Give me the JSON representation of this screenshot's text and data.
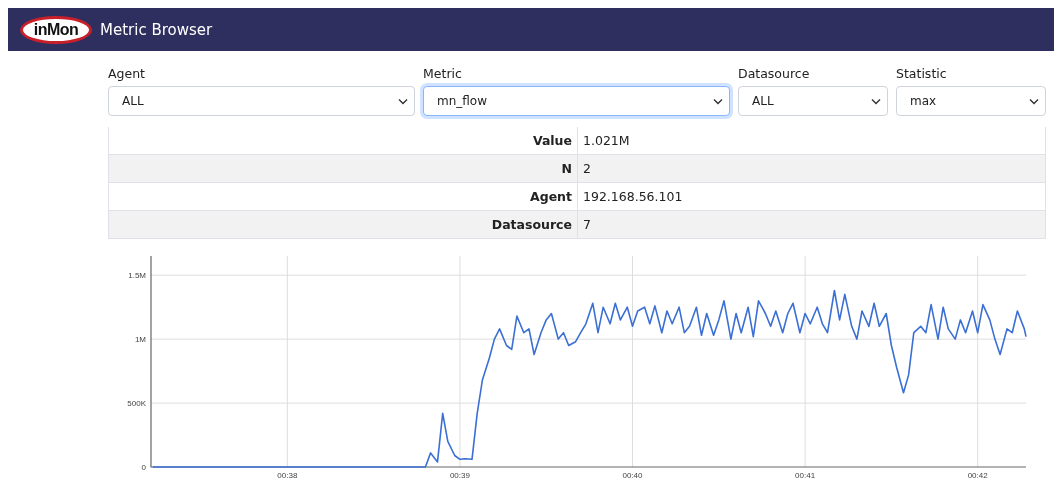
{
  "header": {
    "logo_text": "inMon",
    "title": "Metric Browser"
  },
  "filters": [
    {
      "label": "Agent",
      "value": "ALL",
      "focused": false
    },
    {
      "label": "Metric",
      "value": "mn_flow",
      "focused": true
    },
    {
      "label": "Datasource",
      "value": "ALL",
      "focused": false
    },
    {
      "label": "Statistic",
      "value": "max",
      "focused": false
    }
  ],
  "stats": [
    {
      "name": "Value",
      "value": "1.021M"
    },
    {
      "name": "N",
      "value": "2"
    },
    {
      "name": "Agent",
      "value": "192.168.56.101"
    },
    {
      "name": "Datasource",
      "value": "7"
    }
  ],
  "chart": {
    "chart_data": {
      "type": "line",
      "grid": true,
      "xlim": [
        37.21,
        42.28
      ],
      "ylim": [
        0,
        1650000
      ],
      "xticks": [
        {
          "value": 38,
          "label": "00:38"
        },
        {
          "value": 39,
          "label": "00:39"
        },
        {
          "value": 40,
          "label": "00:40"
        },
        {
          "value": 41,
          "label": "00:41"
        },
        {
          "value": 42,
          "label": "00:42"
        }
      ],
      "yticks": [
        {
          "value": 0,
          "label": "0"
        },
        {
          "value": 500000,
          "label": "500K"
        },
        {
          "value": 1000000,
          "label": "1M"
        },
        {
          "value": 1500000,
          "label": "1.5M"
        }
      ],
      "x": [
        37.22,
        38.8,
        38.83,
        38.87,
        38.9,
        38.93,
        38.97,
        39,
        39.03,
        39.07,
        39.1,
        39.13,
        39.17,
        39.2,
        39.23,
        39.27,
        39.3,
        39.33,
        39.37,
        39.4,
        39.43,
        39.47,
        39.5,
        39.53,
        39.57,
        39.6,
        39.63,
        39.67,
        39.7,
        39.73,
        39.77,
        39.8,
        39.83,
        39.87,
        39.9,
        39.93,
        39.97,
        40,
        40.03,
        40.07,
        40.1,
        40.13,
        40.17,
        40.2,
        40.23,
        40.27,
        40.3,
        40.33,
        40.37,
        40.4,
        40.43,
        40.47,
        40.5,
        40.53,
        40.57,
        40.6,
        40.63,
        40.67,
        40.7,
        40.73,
        40.77,
        40.8,
        40.83,
        40.87,
        40.9,
        40.93,
        40.97,
        41,
        41.03,
        41.07,
        41.1,
        41.13,
        41.17,
        41.2,
        41.23,
        41.27,
        41.3,
        41.33,
        41.37,
        41.4,
        41.43,
        41.47,
        41.5,
        41.53,
        41.57,
        41.6,
        41.63,
        41.67,
        41.7,
        41.73,
        41.77,
        41.8,
        41.83,
        41.87,
        41.9,
        41.93,
        41.97,
        42,
        42.03,
        42.07,
        42.1,
        42.13,
        42.17,
        42.2,
        42.23,
        42.27,
        42.28
      ],
      "series": [
        {
          "color": "#3b6fd4",
          "values": [
            0,
            0,
            110000,
            40000,
            420000,
            200000,
            90000,
            60000,
            65000,
            60000,
            420000,
            680000,
            850000,
            1000000,
            1080000,
            950000,
            920000,
            1180000,
            1050000,
            1080000,
            880000,
            1050000,
            1150000,
            1200000,
            1000000,
            1050000,
            950000,
            980000,
            1050000,
            1120000,
            1280000,
            1050000,
            1250000,
            1120000,
            1280000,
            1150000,
            1250000,
            1100000,
            1220000,
            1250000,
            1120000,
            1260000,
            1050000,
            1220000,
            1120000,
            1250000,
            1050000,
            1100000,
            1250000,
            1030000,
            1200000,
            1030000,
            1150000,
            1300000,
            1000000,
            1200000,
            1050000,
            1250000,
            1020000,
            1300000,
            1200000,
            1100000,
            1220000,
            1050000,
            1200000,
            1280000,
            1050000,
            1200000,
            1120000,
            1250000,
            1120000,
            1050000,
            1380000,
            1150000,
            1350000,
            1100000,
            1000000,
            1220000,
            1100000,
            1280000,
            1100000,
            1200000,
            950000,
            780000,
            580000,
            720000,
            1050000,
            1100000,
            1050000,
            1270000,
            1000000,
            1250000,
            1080000,
            1000000,
            1150000,
            1050000,
            1220000,
            1050000,
            1270000,
            1150000,
            1000000,
            880000,
            1080000,
            1050000,
            1220000,
            1080000,
            1020000
          ]
        }
      ]
    }
  }
}
